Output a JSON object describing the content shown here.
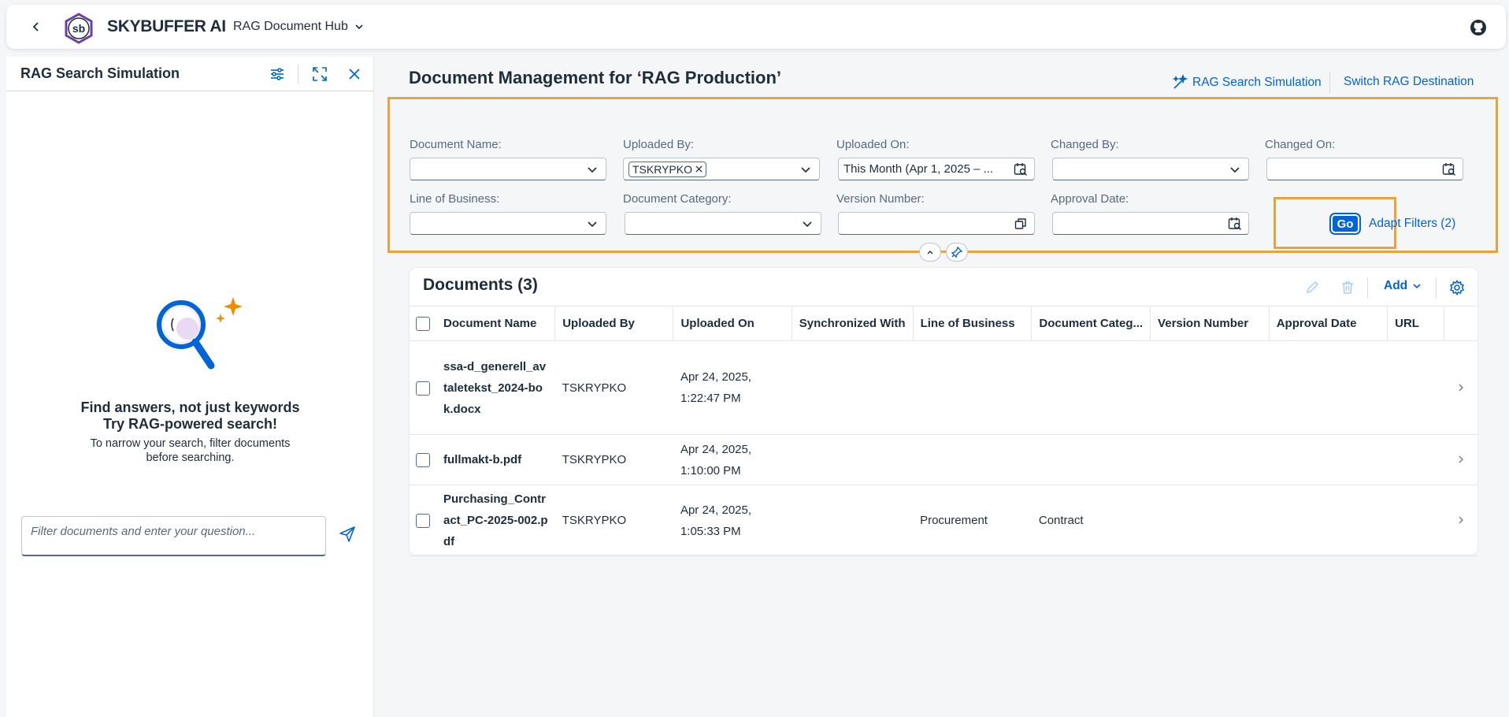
{
  "shell": {
    "brand": "SKYBUFFER AI",
    "logo_text": "sb",
    "app_name": "RAG Document Hub"
  },
  "side_panel": {
    "title": "RAG Search Simulation",
    "empty_title_1": "Find answers, not just keywords",
    "empty_title_2": "Try RAG-powered search!",
    "empty_desc_1": "To narrow your search, filter documents",
    "empty_desc_2": "before searching.",
    "question_placeholder": "Filter documents and enter your question..."
  },
  "header": {
    "title": "Document Management for ‘RAG Production’",
    "rag_search_link": "RAG Search Simulation",
    "switch_link": "Switch RAG Destination"
  },
  "filters": {
    "document_name": {
      "label": "Document Name:",
      "value": ""
    },
    "uploaded_by": {
      "label": "Uploaded By:",
      "token": "TSKRYPKO"
    },
    "uploaded_on": {
      "label": "Uploaded On:",
      "value": "This Month (Apr 1, 2025 – ..."
    },
    "changed_by": {
      "label": "Changed By:",
      "value": ""
    },
    "changed_on": {
      "label": "Changed On:",
      "value": ""
    },
    "line_of_business": {
      "label": "Line of Business:",
      "value": ""
    },
    "document_category": {
      "label": "Document Category:",
      "value": ""
    },
    "version_number": {
      "label": "Version Number:",
      "value": ""
    },
    "approval_date": {
      "label": "Approval Date:",
      "value": ""
    },
    "go_label": "Go",
    "adapt_label": "Adapt Filters (2)"
  },
  "documents": {
    "title": "Documents (3)",
    "add_label": "Add",
    "columns": [
      "Document Name",
      "Uploaded By",
      "Uploaded On",
      "Synchronized With",
      "Line of Business",
      "Document Categ...",
      "Version Number",
      "Approval Date",
      "URL"
    ],
    "rows": [
      {
        "name": "ssa-d_generell_avtaletekst_2024-bok.docx",
        "uploaded_by": "TSKRYPKO",
        "uploaded_on_1": "Apr 24, 2025,",
        "uploaded_on_2": "1:22:47 PM",
        "synchronized_with": "",
        "line_of_business": "",
        "category": "",
        "version": "",
        "approval_date": "",
        "url": ""
      },
      {
        "name": "fullmakt-b.pdf",
        "uploaded_by": "TSKRYPKO",
        "uploaded_on_1": "Apr 24, 2025,",
        "uploaded_on_2": "1:10:00 PM",
        "synchronized_with": "",
        "line_of_business": "",
        "category": "",
        "version": "",
        "approval_date": "",
        "url": ""
      },
      {
        "name": "Purchasing_Contract_PC-2025-002.pdf",
        "uploaded_by": "TSKRYPKO",
        "uploaded_on_1": "Apr 24, 2025,",
        "uploaded_on_2": "1:05:33 PM",
        "synchronized_with": "",
        "line_of_business": "Procurement",
        "category": "Contract",
        "version": "",
        "approval_date": "",
        "url": ""
      }
    ]
  },
  "colors": {
    "accent": "#0064d9",
    "highlight": "#e8a33b",
    "text": "#1d2d3e"
  }
}
